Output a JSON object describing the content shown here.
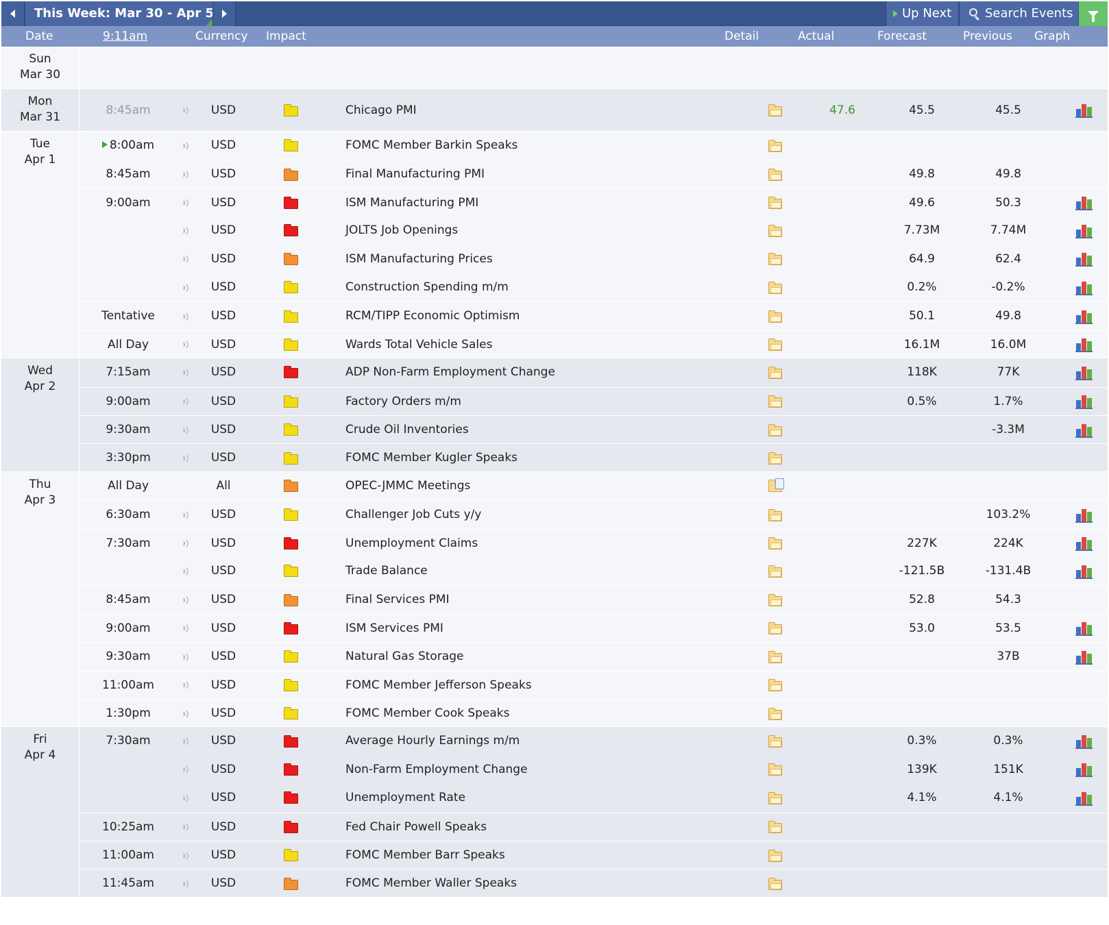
{
  "toolbar": {
    "week_label": "This Week: Mar 30 - Apr 5",
    "up_next": "Up Next",
    "search_events": "Search Events"
  },
  "header": {
    "date": "Date",
    "time": "9:11am",
    "currency": "Currency",
    "impact": "Impact",
    "detail": "Detail",
    "actual": "Actual",
    "forecast": "Forecast",
    "previous": "Previous",
    "graph": "Graph"
  },
  "colors": {
    "topbar": "#38558e",
    "header": "#7f95c5",
    "row_gray": "#e5e8ee",
    "row_light": "#f5f6f9",
    "actual_green": "#3b9a2b",
    "impact_yellow": "#f3dc13",
    "impact_orange": "#f39233",
    "impact_red": "#e81c1c"
  },
  "days": [
    {
      "weekday": "Sun",
      "date": "Mar 30",
      "events": []
    },
    {
      "weekday": "Mon",
      "date": "Mar 31",
      "events": [
        {
          "time": "8:45am",
          "past": true,
          "sound": true,
          "currency": "USD",
          "impact": "yellow",
          "event": "Chicago PMI",
          "detail": "folder",
          "actual": "47.6",
          "forecast": "45.5",
          "previous": "45.5",
          "graph": true
        }
      ]
    },
    {
      "weekday": "Tue",
      "date": "Apr 1",
      "events": [
        {
          "time": "8:00am",
          "next": true,
          "sound": true,
          "currency": "USD",
          "impact": "yellow",
          "event": "FOMC Member Barkin Speaks",
          "detail": "folder",
          "actual": "",
          "forecast": "",
          "previous": "",
          "graph": false
        },
        {
          "time": "8:45am",
          "sound": true,
          "currency": "USD",
          "impact": "orange",
          "event": "Final Manufacturing PMI",
          "detail": "folder",
          "actual": "",
          "forecast": "49.8",
          "previous": "49.8",
          "graph": false
        },
        {
          "time": "9:00am",
          "sound": true,
          "currency": "USD",
          "impact": "red",
          "event": "ISM Manufacturing PMI",
          "detail": "folder",
          "actual": "",
          "forecast": "49.6",
          "previous": "50.3",
          "graph": true
        },
        {
          "time": "",
          "sound": true,
          "currency": "USD",
          "impact": "red",
          "event": "JOLTS Job Openings",
          "detail": "folder",
          "actual": "",
          "forecast": "7.73M",
          "previous": "7.74M",
          "graph": true
        },
        {
          "time": "",
          "sound": true,
          "currency": "USD",
          "impact": "orange",
          "event": "ISM Manufacturing Prices",
          "detail": "folder",
          "actual": "",
          "forecast": "64.9",
          "previous": "62.4",
          "graph": true
        },
        {
          "time": "",
          "sound": true,
          "currency": "USD",
          "impact": "yellow",
          "event": "Construction Spending m/m",
          "detail": "folder",
          "actual": "",
          "forecast": "0.2%",
          "previous": "-0.2%",
          "graph": true
        },
        {
          "time": "Tentative",
          "sound": true,
          "currency": "USD",
          "impact": "yellow",
          "event": "RCM/TIPP Economic Optimism",
          "detail": "folder",
          "actual": "",
          "forecast": "50.1",
          "previous": "49.8",
          "graph": true
        },
        {
          "time": "All Day",
          "sound": true,
          "currency": "USD",
          "impact": "yellow",
          "event": "Wards Total Vehicle Sales",
          "detail": "folder",
          "actual": "",
          "forecast": "16.1M",
          "previous": "16.0M",
          "graph": true
        }
      ]
    },
    {
      "weekday": "Wed",
      "date": "Apr 2",
      "events": [
        {
          "time": "7:15am",
          "sound": true,
          "currency": "USD",
          "impact": "red",
          "event": "ADP Non-Farm Employment Change",
          "detail": "folder",
          "actual": "",
          "forecast": "118K",
          "previous": "77K",
          "graph": true
        },
        {
          "time": "9:00am",
          "sound": true,
          "currency": "USD",
          "impact": "yellow",
          "event": "Factory Orders m/m",
          "detail": "folder",
          "actual": "",
          "forecast": "0.5%",
          "previous": "1.7%",
          "graph": true
        },
        {
          "time": "9:30am",
          "sound": true,
          "currency": "USD",
          "impact": "yellow",
          "event": "Crude Oil Inventories",
          "detail": "folder",
          "actual": "",
          "forecast": "",
          "previous": "-3.3M",
          "graph": true
        },
        {
          "time": "3:30pm",
          "sound": true,
          "currency": "USD",
          "impact": "yellow",
          "event": "FOMC Member Kugler Speaks",
          "detail": "folder",
          "actual": "",
          "forecast": "",
          "previous": "",
          "graph": false
        }
      ]
    },
    {
      "weekday": "Thu",
      "date": "Apr 3",
      "events": [
        {
          "time": "All Day",
          "sound": false,
          "currency": "All",
          "impact": "orange",
          "event": "OPEC-JMMC Meetings",
          "detail": "doc",
          "actual": "",
          "forecast": "",
          "previous": "",
          "graph": false
        },
        {
          "time": "6:30am",
          "sound": true,
          "currency": "USD",
          "impact": "yellow",
          "event": "Challenger Job Cuts y/y",
          "detail": "folder",
          "actual": "",
          "forecast": "",
          "previous": "103.2%",
          "graph": true
        },
        {
          "time": "7:30am",
          "sound": true,
          "currency": "USD",
          "impact": "red",
          "event": "Unemployment Claims",
          "detail": "folder",
          "actual": "",
          "forecast": "227K",
          "previous": "224K",
          "graph": true
        },
        {
          "time": "",
          "sound": true,
          "currency": "USD",
          "impact": "yellow",
          "event": "Trade Balance",
          "detail": "folder",
          "actual": "",
          "forecast": "-121.5B",
          "previous": "-131.4B",
          "graph": true
        },
        {
          "time": "8:45am",
          "sound": true,
          "currency": "USD",
          "impact": "orange",
          "event": "Final Services PMI",
          "detail": "folder",
          "actual": "",
          "forecast": "52.8",
          "previous": "54.3",
          "graph": false
        },
        {
          "time": "9:00am",
          "sound": true,
          "currency": "USD",
          "impact": "red",
          "event": "ISM Services PMI",
          "detail": "folder",
          "actual": "",
          "forecast": "53.0",
          "previous": "53.5",
          "graph": true
        },
        {
          "time": "9:30am",
          "sound": true,
          "currency": "USD",
          "impact": "yellow",
          "event": "Natural Gas Storage",
          "detail": "folder",
          "actual": "",
          "forecast": "",
          "previous": "37B",
          "graph": true
        },
        {
          "time": "11:00am",
          "sound": true,
          "currency": "USD",
          "impact": "yellow",
          "event": "FOMC Member Jefferson Speaks",
          "detail": "folder",
          "actual": "",
          "forecast": "",
          "previous": "",
          "graph": false
        },
        {
          "time": "1:30pm",
          "sound": true,
          "currency": "USD",
          "impact": "yellow",
          "event": "FOMC Member Cook Speaks",
          "detail": "folder",
          "actual": "",
          "forecast": "",
          "previous": "",
          "graph": false
        }
      ]
    },
    {
      "weekday": "Fri",
      "date": "Apr 4",
      "events": [
        {
          "time": "7:30am",
          "sound": true,
          "currency": "USD",
          "impact": "red",
          "event": "Average Hourly Earnings m/m",
          "detail": "folder",
          "actual": "",
          "forecast": "0.3%",
          "previous": "0.3%",
          "graph": true
        },
        {
          "time": "",
          "sound": true,
          "currency": "USD",
          "impact": "red",
          "event": "Non-Farm Employment Change",
          "detail": "folder",
          "actual": "",
          "forecast": "139K",
          "previous": "151K",
          "graph": true
        },
        {
          "time": "",
          "sound": true,
          "currency": "USD",
          "impact": "red",
          "event": "Unemployment Rate",
          "detail": "folder",
          "actual": "",
          "forecast": "4.1%",
          "previous": "4.1%",
          "graph": true
        },
        {
          "time": "10:25am",
          "sound": true,
          "currency": "USD",
          "impact": "red",
          "event": "Fed Chair Powell Speaks",
          "detail": "folder",
          "actual": "",
          "forecast": "",
          "previous": "",
          "graph": false
        },
        {
          "time": "11:00am",
          "sound": true,
          "currency": "USD",
          "impact": "yellow",
          "event": "FOMC Member Barr Speaks",
          "detail": "folder",
          "actual": "",
          "forecast": "",
          "previous": "",
          "graph": false
        },
        {
          "time": "11:45am",
          "sound": true,
          "currency": "USD",
          "impact": "orange",
          "event": "FOMC Member Waller Speaks",
          "detail": "folder",
          "actual": "",
          "forecast": "",
          "previous": "",
          "graph": false
        }
      ]
    }
  ]
}
